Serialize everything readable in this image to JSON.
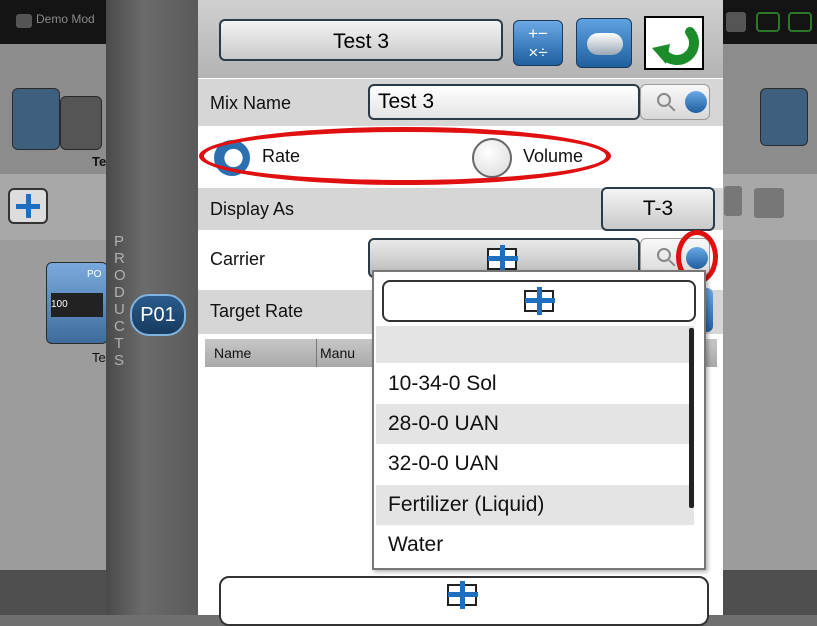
{
  "background": {
    "app_title": "Demo Mod",
    "toolbar_label": "Te",
    "lower_label": "Te",
    "product_tile_text": "100",
    "product_tile_top": "PO"
  },
  "products_tab": {
    "label": "PRODUCTS",
    "badge": "P01"
  },
  "dialog": {
    "title": "Test 3",
    "calc_symbols": "+−\n×÷",
    "mix_name": {
      "label": "Mix Name",
      "value": "Test 3"
    },
    "mode": {
      "selected": "Rate",
      "options": [
        {
          "label": "Rate",
          "selected": true
        },
        {
          "label": "Volume",
          "selected": false
        }
      ]
    },
    "display_as": {
      "label": "Display As",
      "value": "T-3"
    },
    "carrier": {
      "label": "Carrier"
    },
    "target_rate": {
      "label": "Target Rate"
    },
    "table": {
      "columns": [
        "Name",
        "Manu"
      ]
    },
    "carrier_dropdown": {
      "items": [
        "10-34-0 Sol",
        "28-0-0 UAN",
        "32-0-0 UAN",
        "Fertilizer (Liquid)",
        "Water"
      ]
    }
  },
  "colors": {
    "highlight": "#e01010",
    "accent_blue": "#1f6fc0"
  },
  "icons": [
    "calculator-icon",
    "tank-icon",
    "back-arrow-icon",
    "search-icon",
    "up-down-arrows-icon",
    "add-icon"
  ]
}
